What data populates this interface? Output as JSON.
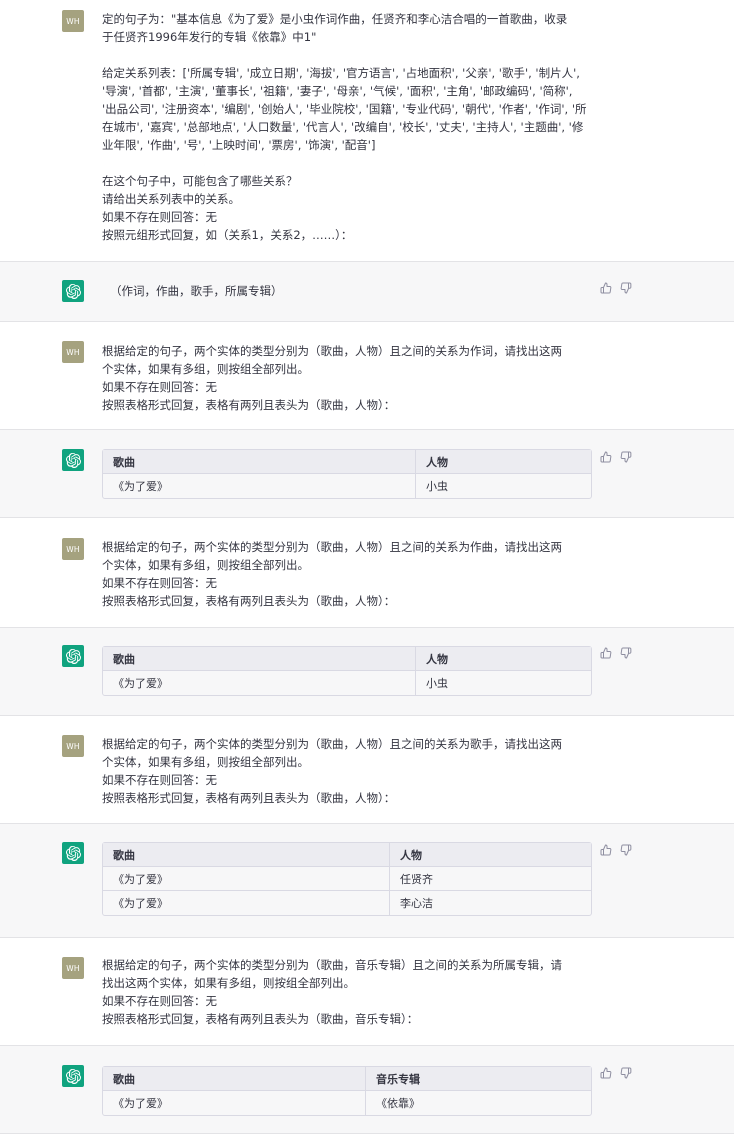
{
  "user_avatar_text": "WH",
  "messages": [
    {
      "role": "user",
      "lines": [
        "定的句子为：\"基本信息《为了爱》是小虫作词作曲，任贤齐和李心洁合唱的一首歌曲，收录",
        "于任贤齐1996年发行的专辑《依靠》中1\"",
        "",
        "给定关系列表：['所属专辑', '成立日期', '海拔', '官方语言', '占地面积', '父亲', '歌手', '制片人',",
        "'导演', '首都', '主演', '董事长', '祖籍', '妻子', '母亲', '气候', '面积', '主角', '邮政编码', '简称',",
        "'出品公司', '注册资本', '编剧', '创始人', '毕业院校', '国籍', '专业代码', '朝代', '作者', '作词', '所",
        "在城市', '嘉宾', '总部地点', '人口数量', '代言人', '改编自', '校长', '丈夫', '主持人', '主题曲', '修",
        "业年限', '作曲', '号', '上映时间', '票房', '饰演', '配音']",
        "",
        "在这个句子中，可能包含了哪些关系？",
        "请给出关系列表中的关系。",
        "如果不存在则回答：无",
        "按照元组形式回复，如（关系1，关系2，……）："
      ]
    },
    {
      "role": "assistant",
      "lines": [
        "（作词，作曲，歌手，所属专辑）"
      ]
    },
    {
      "role": "user",
      "lines": [
        "根据给定的句子，两个实体的类型分别为（歌曲，人物）且之间的关系为作词，请找出这两",
        "个实体，如果有多组，则按组全部列出。",
        "如果不存在则回答：无",
        "按照表格形式回复，表格有两列且表头为（歌曲，人物）："
      ]
    },
    {
      "role": "assistant",
      "table": {
        "headers": [
          "歌曲",
          "人物"
        ],
        "rows": [
          [
            "《为了爱》",
            "小虫"
          ]
        ]
      }
    },
    {
      "role": "user",
      "lines": [
        "根据给定的句子，两个实体的类型分别为（歌曲，人物）且之间的关系为作曲，请找出这两",
        "个实体，如果有多组，则按组全部列出。",
        "如果不存在则回答：无",
        "按照表格形式回复，表格有两列且表头为（歌曲，人物）："
      ]
    },
    {
      "role": "assistant",
      "table": {
        "headers": [
          "歌曲",
          "人物"
        ],
        "rows": [
          [
            "《为了爱》",
            "小虫"
          ]
        ]
      }
    },
    {
      "role": "user",
      "lines": [
        "根据给定的句子，两个实体的类型分别为（歌曲，人物）且之间的关系为歌手，请找出这两",
        "个实体，如果有多组，则按组全部列出。",
        "如果不存在则回答：无",
        "按照表格形式回复，表格有两列且表头为（歌曲，人物）："
      ]
    },
    {
      "role": "assistant",
      "table": {
        "headers": [
          "歌曲",
          "人物"
        ],
        "rows": [
          [
            "《为了爱》",
            "任贤齐"
          ],
          [
            "《为了爱》",
            "李心洁"
          ]
        ]
      }
    },
    {
      "role": "user",
      "lines": [
        "根据给定的句子，两个实体的类型分别为（歌曲，音乐专辑）且之间的关系为所属专辑，请",
        "找出这两个实体，如果有多组，则按组全部列出。",
        "如果不存在则回答：无",
        "按照表格形式回复，表格有两列且表头为（歌曲，音乐专辑）："
      ]
    },
    {
      "role": "assistant",
      "table": {
        "headers": [
          "歌曲",
          "音乐专辑"
        ],
        "rows": [
          [
            "《为了爱》",
            "《依靠》"
          ]
        ]
      }
    }
  ],
  "icons": {
    "like": "thumbs-up-icon",
    "dislike": "thumbs-down-icon",
    "assistant": "openai-logo-icon"
  },
  "colors": {
    "user_avatar": "#a5a27f",
    "assistant_avatar": "#10a37f",
    "assistant_bg": "#f7f7f8"
  }
}
